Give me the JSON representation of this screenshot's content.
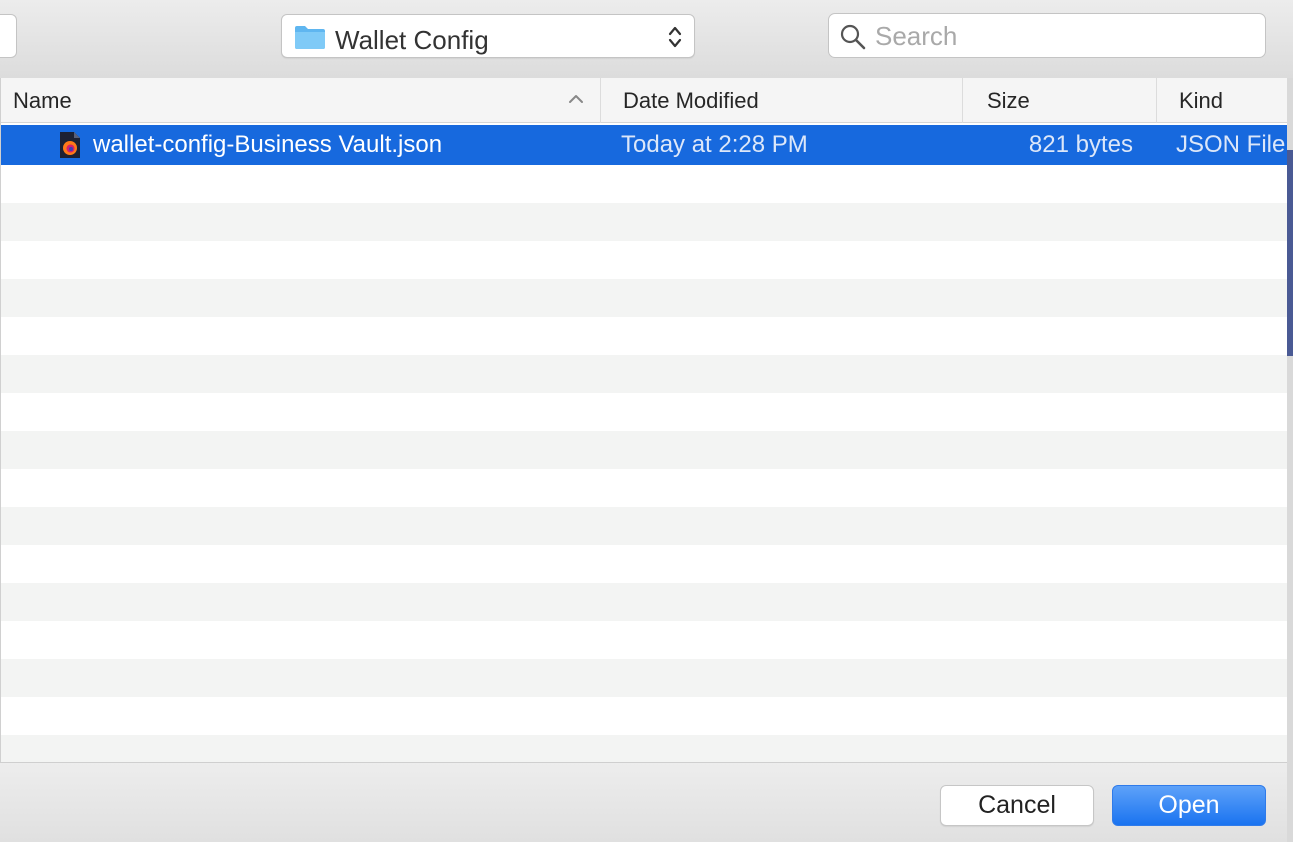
{
  "toolbar": {
    "location": "Wallet Config",
    "search_placeholder": "Search"
  },
  "file_list": {
    "columns": {
      "name": "Name",
      "date_modified": "Date Modified",
      "size": "Size",
      "kind": "Kind"
    },
    "sort_indicator": "chevron-up-icon",
    "files": [
      {
        "name": "wallet-config-Business Vault.json",
        "date_modified": "Today at 2:28 PM",
        "size": "821 bytes",
        "kind": "JSON File",
        "icon": "firefox-document-icon",
        "selected": true
      }
    ]
  },
  "buttons": {
    "cancel": "Cancel",
    "open": "Open"
  },
  "colors": {
    "selection": "#1769de",
    "primary_button": "#1a73f0",
    "folder": "#6ec1f5"
  }
}
